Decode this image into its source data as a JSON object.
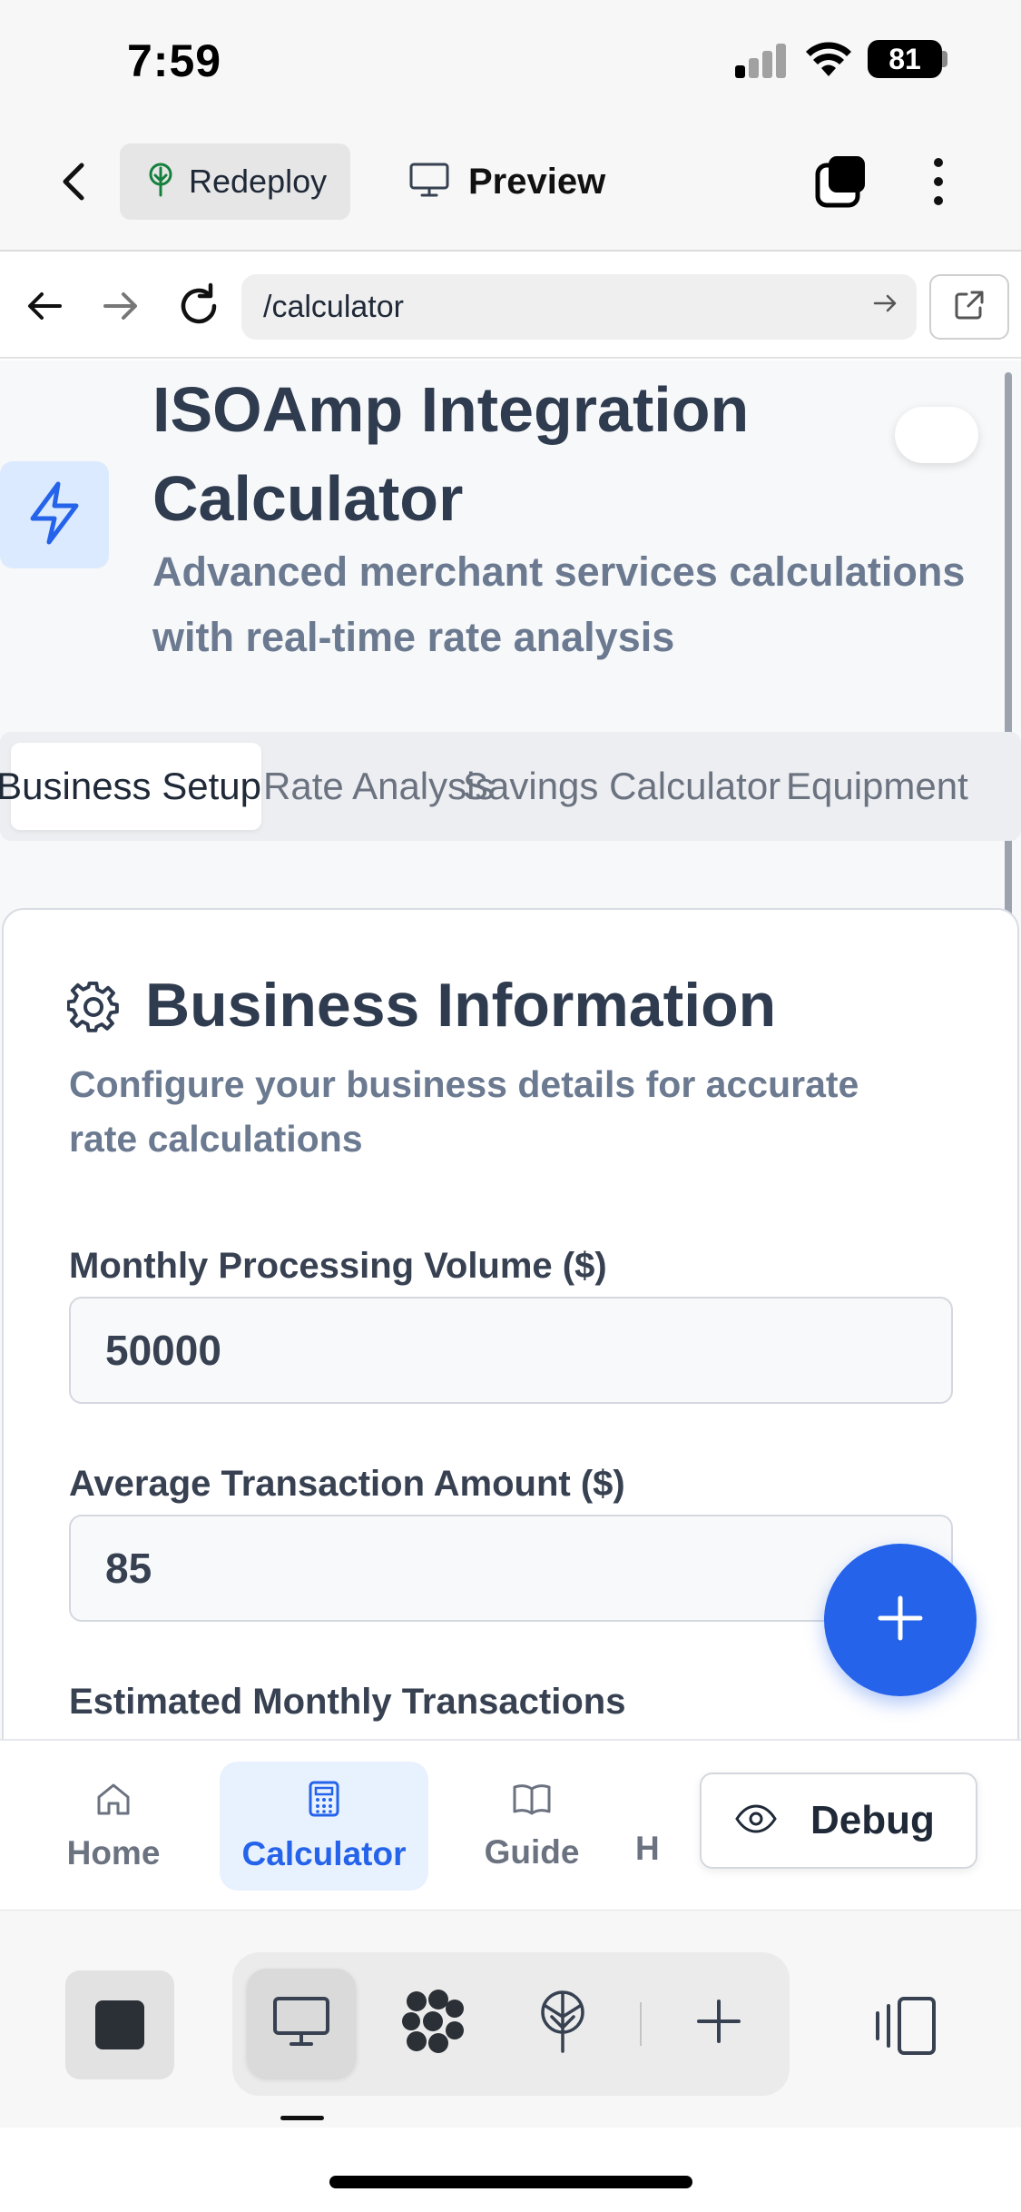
{
  "status_bar": {
    "time": "7:59",
    "battery": "81"
  },
  "header": {
    "redeploy_label": "Redeploy",
    "preview_label": "Preview"
  },
  "url_bar": {
    "url": "/calculator"
  },
  "page": {
    "title": "ISOAmp Integration Calculator",
    "subtitle": "Advanced merchant services calculations with real-time rate analysis",
    "tabs": [
      {
        "label": "Business Setup",
        "active": true
      },
      {
        "label": "Rate Analysis",
        "active": false
      },
      {
        "label": "Savings Calculator",
        "active": false
      },
      {
        "label": "Equipment",
        "active": false
      }
    ]
  },
  "card": {
    "title": "Business Information",
    "description": "Configure your business details for accurate rate calculations",
    "fields": [
      {
        "label": "Monthly Processing Volume ($)",
        "value": "50000"
      },
      {
        "label": "Average Transaction Amount ($)",
        "value": "85"
      },
      {
        "label": "Estimated Monthly Transactions",
        "value": ""
      }
    ]
  },
  "bottom_nav": {
    "items": [
      {
        "label": "Home",
        "icon": "home-icon",
        "active": false
      },
      {
        "label": "Calculator",
        "icon": "calculator-icon",
        "active": true
      },
      {
        "label": "Guide",
        "icon": "book-icon",
        "active": false
      },
      {
        "label": "H",
        "icon": "",
        "active": false
      }
    ],
    "debug_label": "Debug"
  },
  "colors": {
    "accent": "#2563eb",
    "title": "#2f3b4f",
    "muted": "#6b7a90",
    "active_nav_bg": "#e8f1fe"
  }
}
